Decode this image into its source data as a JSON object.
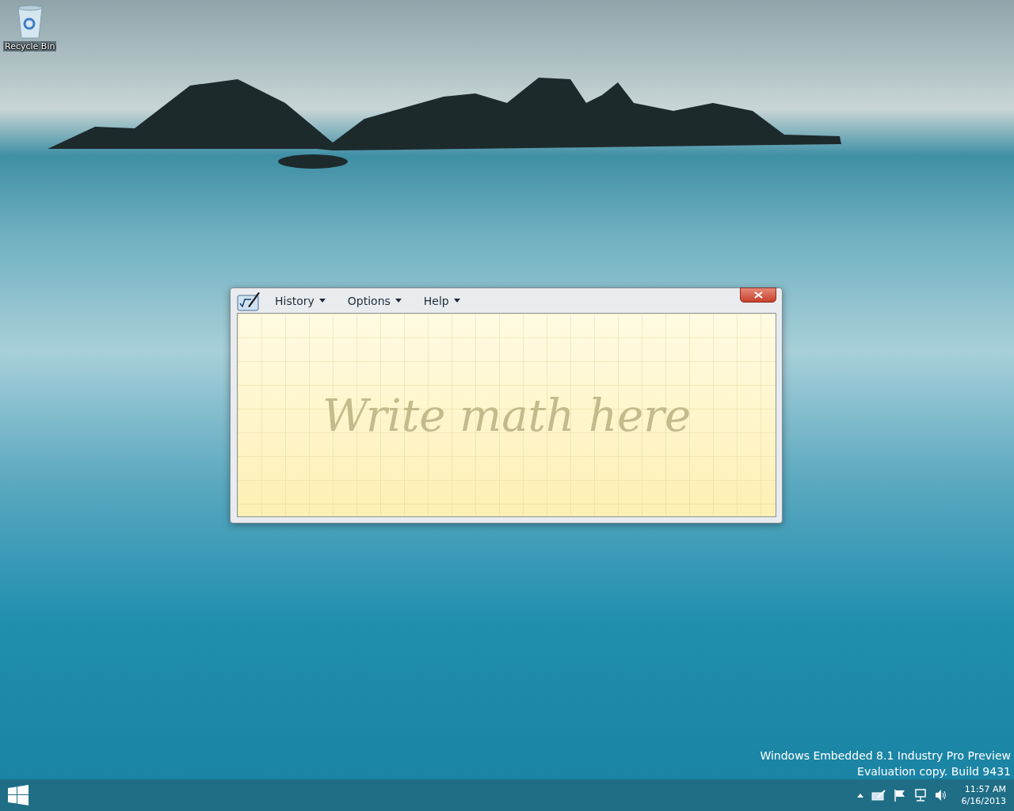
{
  "desktop": {
    "icons": [
      {
        "label": "Recycle Bin"
      }
    ]
  },
  "window": {
    "menu": [
      {
        "label": "History"
      },
      {
        "label": "Options"
      },
      {
        "label": "Help"
      }
    ],
    "writing_area": {
      "hint": "Write math here"
    }
  },
  "desktop_notice": [
    "Windows Embedded 8.1 Industry Pro Preview",
    "Evaluation copy. Build 9431"
  ],
  "taskbar": {
    "time": "11:57 AM",
    "date": "6/16/2013"
  }
}
